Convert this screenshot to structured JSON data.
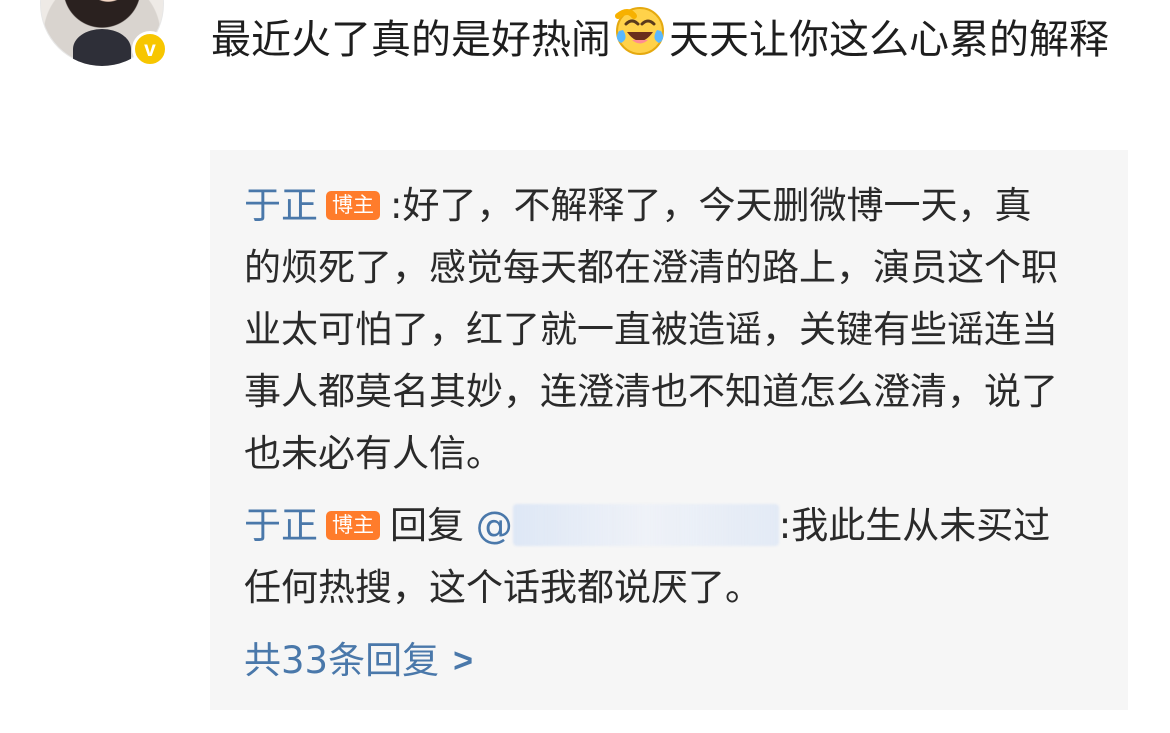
{
  "user": {
    "avatar_icon": "user-avatar",
    "verified_icon": "verified-badge",
    "verified_mark": "v"
  },
  "comment": {
    "text_part_1": "最近火了真的是好热闹",
    "emoji": "laughing-tears-emoji",
    "text_part_2": "天天让你这么心累的解释"
  },
  "replies": [
    {
      "author": "于正",
      "badge": "博主",
      "separator": ":",
      "text": "好了，不解释了，今天删微博一天，真的烦死了，感觉每天都在澄清的路上，演员这个职业太可怕了，红了就一直被造谣，关键有些谣连当事人都莫名其妙，连澄清也不知道怎么澄清，说了也未必有人信。"
    },
    {
      "author": "于正",
      "badge": "博主",
      "reply_word": "回复",
      "mention": "@",
      "mention_note": "blurred-username",
      "separator": ":",
      "text": "我此生从未买过任何热搜，这个话我都说厌了。"
    }
  ],
  "reply_count": {
    "label": "共33条回复",
    "icon": "chevron-right-icon",
    "arrow": ">"
  },
  "colors": {
    "background": "#ffffff",
    "panel": "#f6f6f6",
    "author_blue": "#4a78aa",
    "badge_orange": "#ff7c2b",
    "verified_yellow": "#f7c600"
  }
}
